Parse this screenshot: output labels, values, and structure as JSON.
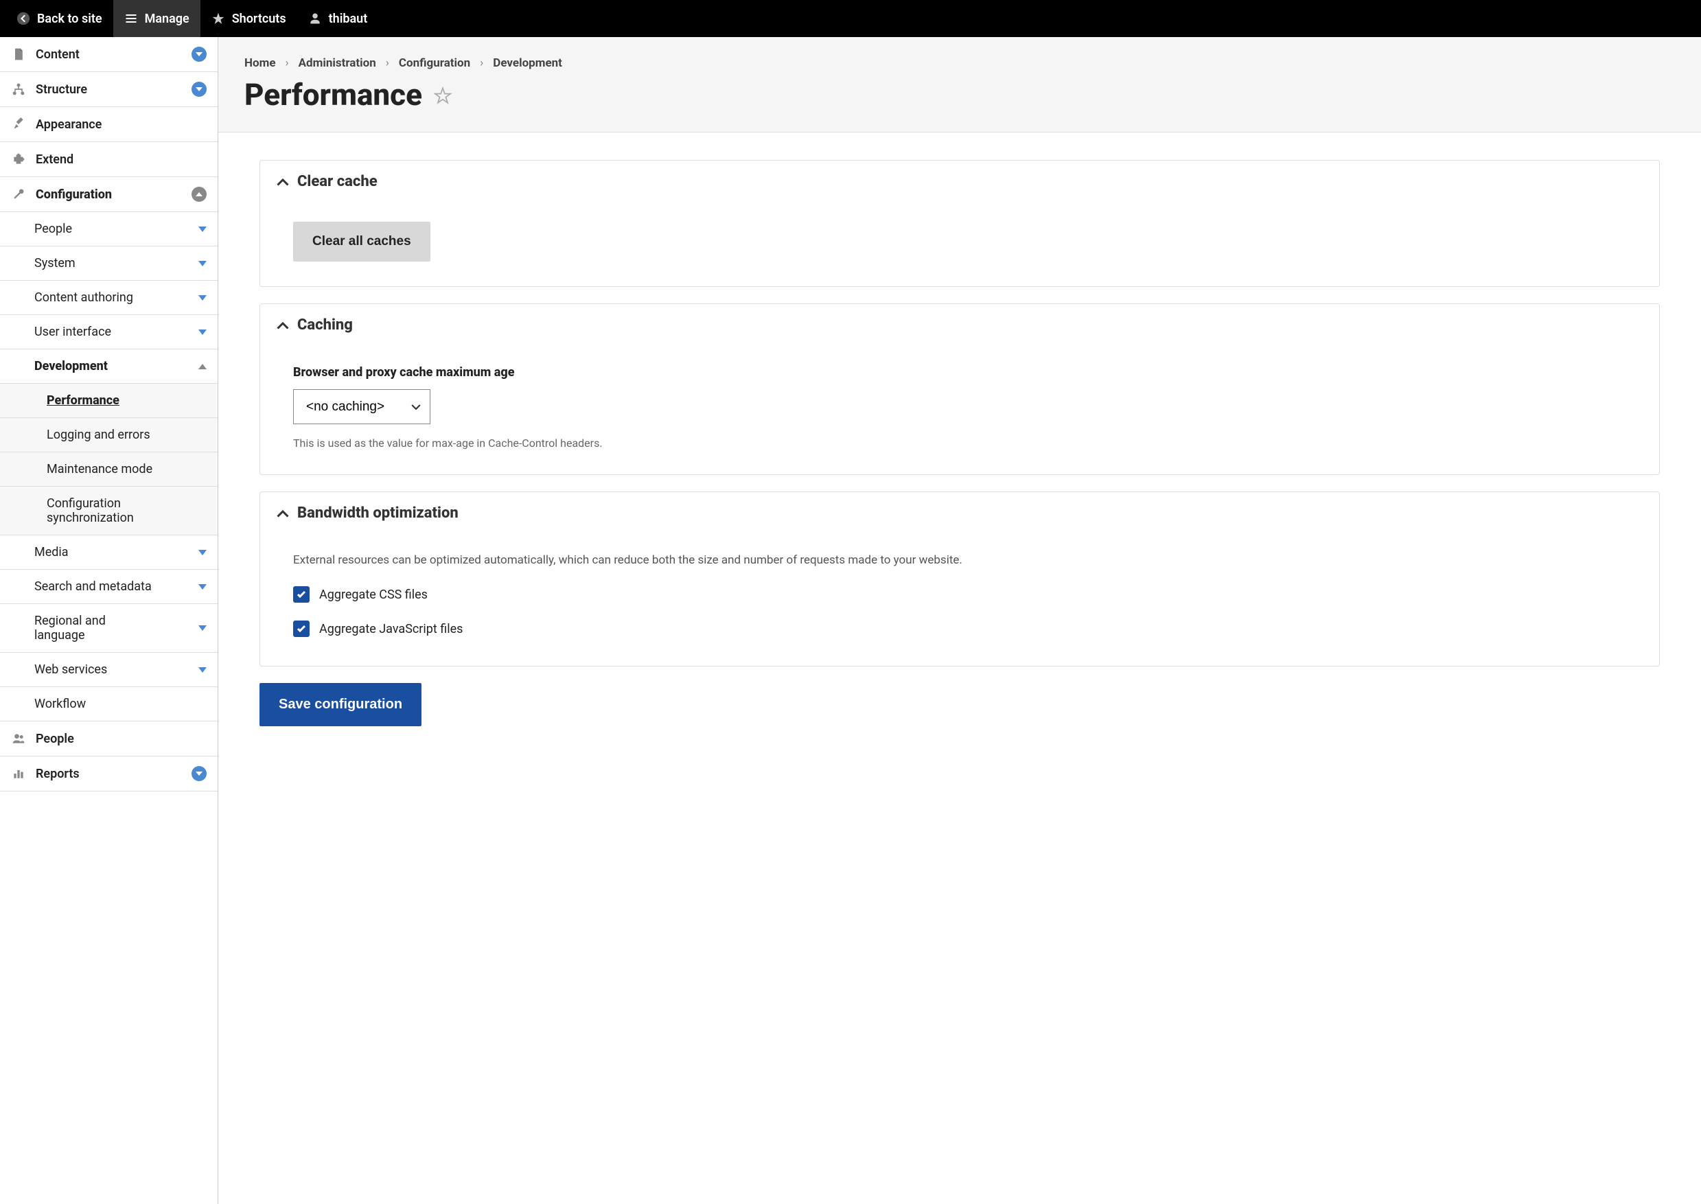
{
  "toolbar": {
    "back": "Back to site",
    "manage": "Manage",
    "shortcuts": "Shortcuts",
    "user": "thibaut"
  },
  "sidebar": {
    "content": "Content",
    "structure": "Structure",
    "appearance": "Appearance",
    "extend": "Extend",
    "configuration": "Configuration",
    "config_children": {
      "people": "People",
      "system": "System",
      "content_authoring": "Content authoring",
      "user_interface": "User interface",
      "development": "Development",
      "dev_children": {
        "performance": "Performance",
        "logging": "Logging and errors",
        "maintenance": "Maintenance mode",
        "config_sync": "Configuration synchronization"
      },
      "media": "Media",
      "search": "Search and metadata",
      "regional": "Regional and language",
      "web_services": "Web services",
      "workflow": "Workflow"
    },
    "people": "People",
    "reports": "Reports"
  },
  "breadcrumb": {
    "home": "Home",
    "admin": "Administration",
    "config": "Configuration",
    "dev": "Development"
  },
  "page_title": "Performance",
  "panels": {
    "clear_cache": {
      "title": "Clear cache",
      "button": "Clear all caches"
    },
    "caching": {
      "title": "Caching",
      "field_label": "Browser and proxy cache maximum age",
      "select_value": "<no caching>",
      "help": "This is used as the value for max-age in Cache-Control headers."
    },
    "bandwidth": {
      "title": "Bandwidth optimization",
      "desc": "External resources can be optimized automatically, which can reduce both the size and number of requests made to your website.",
      "aggregate_css": "Aggregate CSS files",
      "aggregate_js": "Aggregate JavaScript files"
    }
  },
  "save_button": "Save configuration"
}
